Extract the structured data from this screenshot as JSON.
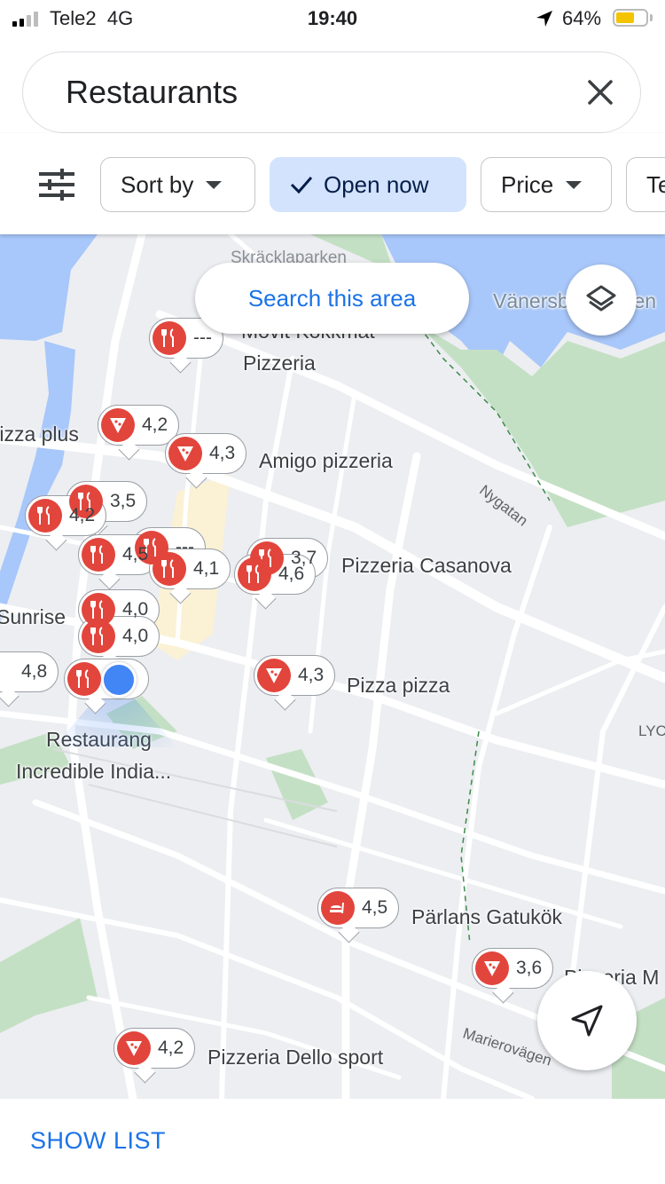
{
  "status_bar": {
    "carrier": "Tele2",
    "network": "4G",
    "time": "19:40",
    "battery": "64%",
    "battery_color": "#f4c400"
  },
  "search": {
    "query": "Restaurants",
    "clear_icon": "close-icon"
  },
  "filters": {
    "filter_icon": "tune-icon",
    "chips": [
      {
        "label": "Sort by",
        "dropdown": true,
        "active": false
      },
      {
        "label": "Open now",
        "dropdown": false,
        "active": true
      },
      {
        "label": "Price",
        "dropdown": true,
        "active": false
      },
      {
        "label": "Te",
        "dropdown": false,
        "active": false
      }
    ]
  },
  "map": {
    "search_area_label": "Search this area",
    "layers_icon": "layers-icon",
    "my_location_icon": "navigation-arrow-icon",
    "place_labels": [
      "Skräcklaparken",
      "Vänersborgsviken",
      "Movit Kökkmat",
      "Pizzeria",
      "Pizza plus",
      "Amigo pizzeria",
      "Pizzeria Casanova",
      "Sunrise",
      "Pizza pizza",
      "Restaurang",
      "Incredible India...",
      "Pärlans Gatukök",
      "Pizzeria M",
      "Pizzeria Dello sport"
    ],
    "streets": [
      "Nygatan",
      "Marierovägen",
      "LYC"
    ],
    "markers": [
      {
        "icon": "restaurant-icon",
        "rating": "---"
      },
      {
        "icon": "pizza-icon",
        "rating": "4,2"
      },
      {
        "icon": "pizza-icon",
        "rating": "4,3"
      },
      {
        "icon": "restaurant-icon",
        "rating": "3,5"
      },
      {
        "icon": "restaurant-icon",
        "rating": "4,2"
      },
      {
        "icon": "restaurant-icon",
        "rating": "4,5"
      },
      {
        "icon": "restaurant-icon",
        "rating": "---"
      },
      {
        "icon": "restaurant-icon",
        "rating": "4,1"
      },
      {
        "icon": "restaurant-icon",
        "rating": "3,7"
      },
      {
        "icon": "restaurant-icon",
        "rating": "4,6"
      },
      {
        "icon": "restaurant-icon",
        "rating": "4,0"
      },
      {
        "icon": "restaurant-icon",
        "rating": "4,0"
      },
      {
        "icon": "restaurant-icon",
        "rating": "4,8"
      },
      {
        "icon": "restaurant-icon",
        "rating": ""
      },
      {
        "icon": "pizza-icon",
        "rating": "4,3"
      },
      {
        "icon": "fast-food-icon",
        "rating": "4,5"
      },
      {
        "icon": "pizza-icon",
        "rating": "3,6"
      },
      {
        "icon": "pizza-icon",
        "rating": "4,2"
      }
    ],
    "colors": {
      "water": "#a8c7fa",
      "park": "#c4e0c4",
      "marker": "#e2453c",
      "road": "#ffffff"
    }
  },
  "bottom": {
    "show_list": "SHOW LIST"
  }
}
